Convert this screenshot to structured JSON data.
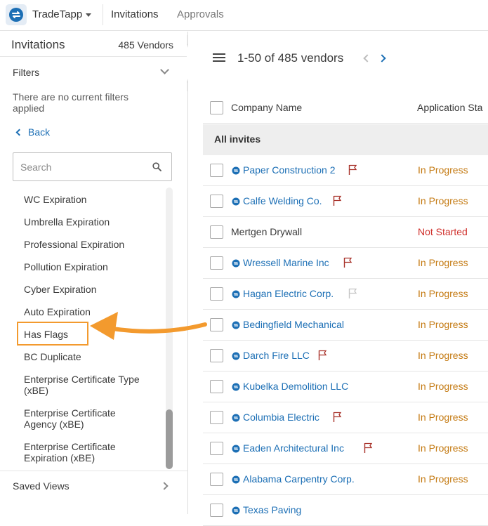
{
  "app": {
    "name": "TradeTapp",
    "tabs": [
      "Invitations",
      "Approvals"
    ]
  },
  "sidebar": {
    "title": "Invitations",
    "count": "485 Vendors",
    "filters_label": "Filters",
    "no_filters_text": "There are no current filters applied",
    "back_label": "Back",
    "search_placeholder": "Search",
    "filter_items": [
      "WC Expiration",
      "Umbrella Expiration",
      "Professional Expiration",
      "Pollution Expiration",
      "Cyber Expiration",
      "Auto Expiration",
      "Has Flags",
      "BC Duplicate",
      "Enterprise Certificate Type (xBE)",
      "Enterprise Certificate Agency (xBE)",
      "Enterprise Certificate Expiration (xBE)"
    ],
    "highlighted_item": "Has Flags",
    "saved_views_label": "Saved Views"
  },
  "main": {
    "pager_text": "1-50 of 485 vendors",
    "columns": [
      "Company Name",
      "Application Sta"
    ],
    "group_label": "All invites",
    "rows": [
      {
        "company": "Paper Construction 2",
        "invited": true,
        "flag": "red",
        "status": "In Progress"
      },
      {
        "company": "Calfe Welding Co.",
        "invited": true,
        "flag": "red",
        "status": "In Progress"
      },
      {
        "company": "Mertgen Drywall",
        "invited": false,
        "flag": "none",
        "status": "Not Started"
      },
      {
        "company": "Wressell Marine Inc",
        "invited": true,
        "flag": "red",
        "status": "In Progress"
      },
      {
        "company": "Hagan Electric Corp.",
        "invited": true,
        "flag": "grey",
        "status": "In Progress"
      },
      {
        "company": "Bedingfield Mechanical",
        "invited": true,
        "flag": "none",
        "status": "In Progress"
      },
      {
        "company": "Darch Fire LLC",
        "invited": true,
        "flag": "red",
        "status": "In Progress"
      },
      {
        "company": "Kubelka Demolition LLC",
        "invited": true,
        "flag": "none",
        "status": "In Progress"
      },
      {
        "company": "Columbia Electric",
        "invited": true,
        "flag": "red",
        "status": "In Progress"
      },
      {
        "company": "Eaden Architectural Inc",
        "invited": true,
        "flag": "red",
        "status": "In Progress"
      },
      {
        "company": "Alabama Carpentry Corp.",
        "invited": true,
        "flag": "none",
        "status": "In Progress"
      },
      {
        "company": "Texas Paving",
        "invited": true,
        "flag": "none",
        "status": ""
      }
    ]
  },
  "colors": {
    "link": "#1c6fb5",
    "in_progress": "#c47a12",
    "not_started": "#d0312d",
    "flag_red": "#a8322a",
    "flag_grey": "#c4c4c4",
    "highlight": "#f39a2e"
  },
  "icons": [
    "tradetapp-logo-icon",
    "caret-down-icon",
    "chevron-down-icon",
    "chevron-left-icon",
    "search-icon",
    "chevron-right-icon",
    "hamburger-icon",
    "invite-icon",
    "flag-icon",
    "arrow-annotation-icon"
  ]
}
